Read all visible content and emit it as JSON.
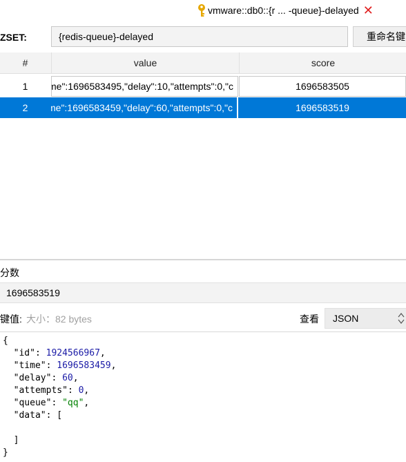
{
  "tab": {
    "title": "vmware::db0::{r ... -queue}-delayed",
    "close_glyph": "✕",
    "icon": "key-icon",
    "close_color": "#e02020"
  },
  "key": {
    "type_label": "ZSET:",
    "name": "{redis-queue}-delayed",
    "rename_label": "重命名键"
  },
  "table": {
    "headers": [
      "#",
      "value",
      "score"
    ],
    "rows": [
      {
        "index": "1",
        "value": "me\":1696583495,\"delay\":10,\"attempts\":0,\"c",
        "score": "1696583505"
      },
      {
        "index": "2",
        "value": "me\":1696583459,\"delay\":60,\"attempts\":0,\"c",
        "score": "1696583519"
      }
    ],
    "selected_row": 2,
    "selection_color": "#0078d7"
  },
  "score": {
    "label": "分数",
    "value": "1696583519"
  },
  "value_panel": {
    "label": "键值:",
    "size": "大小：82 bytes",
    "view_label": "查看",
    "view_mode": "JSON"
  },
  "json_lines": [
    {
      "text": "{"
    },
    {
      "key": "\"id\"",
      "value": "1924566967",
      "kind": "num",
      "comma": ","
    },
    {
      "key": "\"time\"",
      "value": "1696583459",
      "kind": "num",
      "comma": ","
    },
    {
      "key": "\"delay\"",
      "value": "60",
      "kind": "num",
      "comma": ","
    },
    {
      "key": "\"attempts\"",
      "value": "0",
      "kind": "num",
      "comma": ","
    },
    {
      "key": "\"queue\"",
      "value": "\"qq\"",
      "kind": "str",
      "comma": ","
    },
    {
      "key": "\"data\"",
      "value": "[",
      "kind": "plain",
      "comma": ""
    },
    {
      "text": ""
    },
    {
      "text": "  ]"
    },
    {
      "text": "}"
    }
  ]
}
